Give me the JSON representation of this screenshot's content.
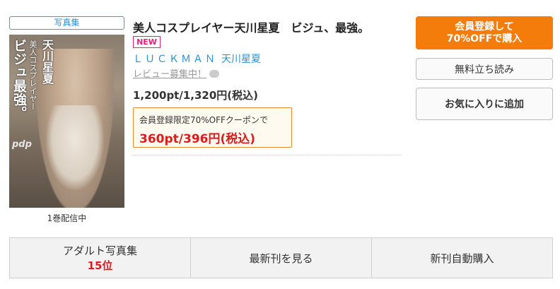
{
  "genre_tag": "写真集",
  "cover": {
    "text_title": "ビジュ最強。",
    "text_sub": "美人コスプレイヤー",
    "text_name": "天川星夏",
    "logo": "pdp"
  },
  "volume_status": "1巻配信中",
  "title": "美人コスプレイヤー天川星夏　ビジュ、最強。",
  "new_badge": "NEW",
  "publisher": "ＬＵＣＫＭＡＮ",
  "author": "天川星夏",
  "review_link": "レビュー募集中！",
  "price": "1,200pt/1,320円(税込)",
  "coupon": {
    "label": "会員登録限定70%OFFクーポンで",
    "price": "360pt/396円(税込)"
  },
  "buttons": {
    "register_line1": "会員登録して",
    "register_line2": "70%OFFで購入",
    "trial": "無料立ち読み",
    "favorite": "お気に入りに追加"
  },
  "bottom": {
    "ranking_label": "アダルト写真集",
    "ranking_value": "15位",
    "latest": "最新刊を見る",
    "auto_purchase": "新刊自動購入"
  },
  "colors": {
    "accent_orange": "#f47c0a",
    "link_blue": "#2a8fd0",
    "price_red": "#d81e1e",
    "new_pink": "#e8207a"
  }
}
